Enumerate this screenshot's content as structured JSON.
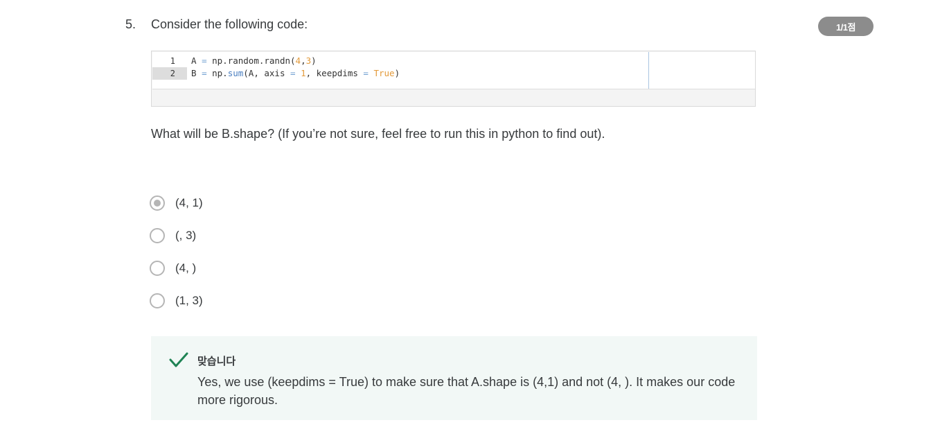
{
  "question": {
    "number": "5.",
    "title": "Consider the following code:",
    "score": "1/1점",
    "code": {
      "line_numbers": [
        "1",
        "2"
      ],
      "lines": [
        [
          {
            "t": "A ",
            "c": "plain"
          },
          {
            "t": "=",
            "c": "op"
          },
          {
            "t": " np.random.randn(",
            "c": "plain"
          },
          {
            "t": "4",
            "c": "num"
          },
          {
            "t": ",",
            "c": "plain"
          },
          {
            "t": "3",
            "c": "num"
          },
          {
            "t": ")",
            "c": "plain"
          }
        ],
        [
          {
            "t": "B ",
            "c": "plain"
          },
          {
            "t": "=",
            "c": "op"
          },
          {
            "t": " np.",
            "c": "plain"
          },
          {
            "t": "sum",
            "c": "fn"
          },
          {
            "t": "(A, axis ",
            "c": "plain"
          },
          {
            "t": "=",
            "c": "op"
          },
          {
            "t": " ",
            "c": "plain"
          },
          {
            "t": "1",
            "c": "num"
          },
          {
            "t": ", keepdims ",
            "c": "plain"
          },
          {
            "t": "=",
            "c": "op"
          },
          {
            "t": " ",
            "c": "plain"
          },
          {
            "t": "True",
            "c": "kw"
          },
          {
            "t": ")",
            "c": "plain"
          }
        ]
      ]
    },
    "prompt": "What will be B.shape? (If you’re not sure, feel free to run this in python to find out).",
    "options": [
      {
        "label": "(4, 1)",
        "selected": true
      },
      {
        "label": "(, 3)",
        "selected": false
      },
      {
        "label": "(4, )",
        "selected": false
      },
      {
        "label": "(1, 3)",
        "selected": false
      }
    ],
    "feedback": {
      "title": "맞습니다",
      "text": "Yes, we use (keepdims = True) to make sure that A.shape is (4,1) and not (4, ). It makes our code more rigorous.",
      "icon": "check-icon",
      "icon_color": "#1f8354",
      "bg_color": "#f2f8f6"
    },
    "colors": {
      "badge": "#8c8c8c",
      "text": "#373a3c"
    }
  }
}
